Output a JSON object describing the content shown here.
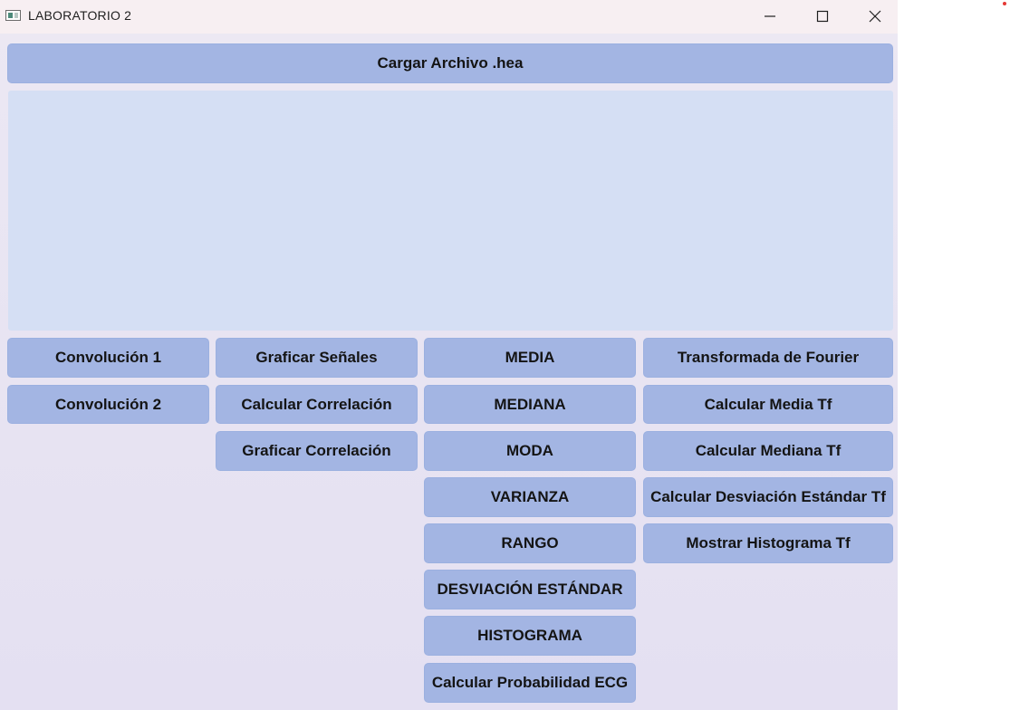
{
  "window": {
    "title": "LABORATORIO 2"
  },
  "top_button": "Cargar Archivo .hea",
  "columns": {
    "col1": [
      "Convolución 1",
      "Convolución 2"
    ],
    "col2": [
      "Graficar Señales",
      "Calcular Correlación",
      "Graficar Correlación"
    ],
    "col3": [
      "MEDIA",
      "MEDIANA",
      "MODA",
      "VARIANZA",
      "RANGO",
      "DESVIACIÓN ESTÁNDAR",
      "HISTOGRAMA",
      "Calcular Probabilidad ECG"
    ],
    "col4": [
      "Transformada de Fourier",
      "Calcular Media Tf",
      "Calcular Mediana Tf",
      "Calcular Desviación Estándar Tf",
      "Mostrar Histograma Tf"
    ]
  },
  "colors": {
    "button_bg": "#a3b5e3",
    "plot_bg": "#d5dff4",
    "window_bg": "#e4e0f2",
    "titlebar_bg": "#f7eff2"
  },
  "icons": {
    "app": "app-icon",
    "minimize": "minimize-icon",
    "maximize": "maximize-icon",
    "close": "close-icon"
  }
}
